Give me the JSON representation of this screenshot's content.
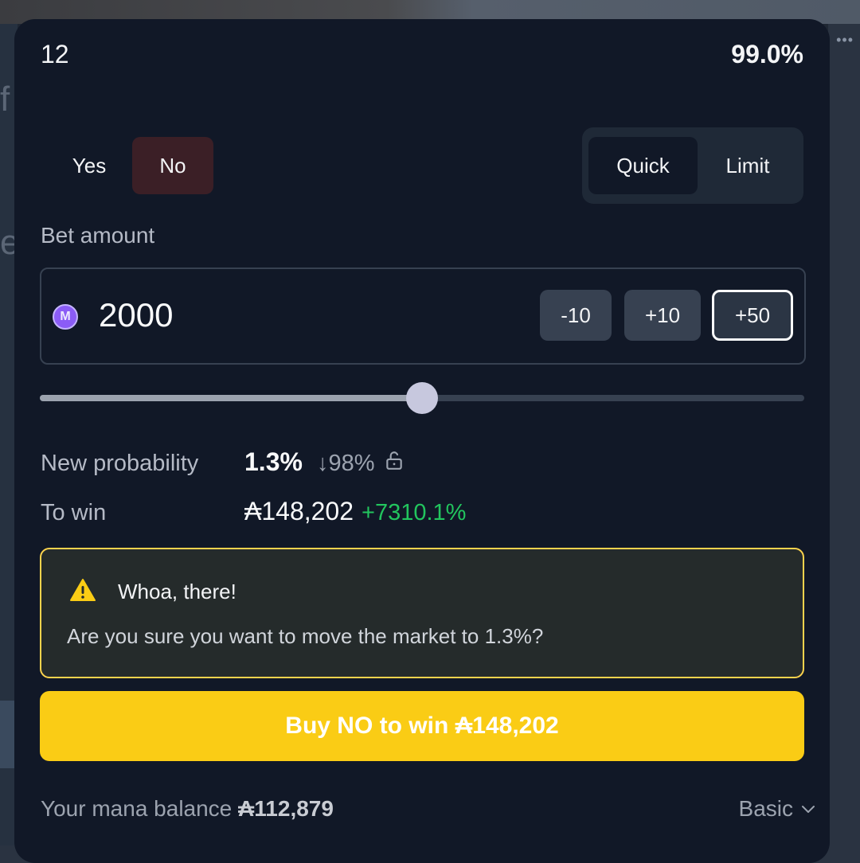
{
  "header": {
    "left_label": "12",
    "probability": "99.0%"
  },
  "outcome": {
    "yes_label": "Yes",
    "no_label": "No",
    "selected": "No"
  },
  "mode": {
    "quick_label": "Quick",
    "limit_label": "Limit",
    "selected": "Quick"
  },
  "bet": {
    "label": "Bet amount",
    "currency_symbol": "M",
    "value": "2000",
    "increments": [
      "-10",
      "+10",
      "+50"
    ],
    "slider_fraction": 0.5
  },
  "info": {
    "new_prob_label": "New probability",
    "new_prob_value": "1.3%",
    "new_prob_delta": "↓98%",
    "to_win_label": "To win",
    "to_win_value": "₳148,202",
    "to_win_gain": "+7310.1%"
  },
  "warning": {
    "title": "Whoa, there!",
    "message": "Are you sure you want to move the market to 1.3%?"
  },
  "buy_button": {
    "label": "Buy NO to win ₳148,202"
  },
  "footer": {
    "balance_label": "Your mana balance",
    "balance_value": "₳112,879",
    "mode_label": "Basic"
  },
  "colors": {
    "panel_bg": "#111827",
    "no_selected_bg": "#3b1f26",
    "buy_button": "#facc15",
    "warning_border": "#fcd34d",
    "gain_green": "#22c55e"
  }
}
